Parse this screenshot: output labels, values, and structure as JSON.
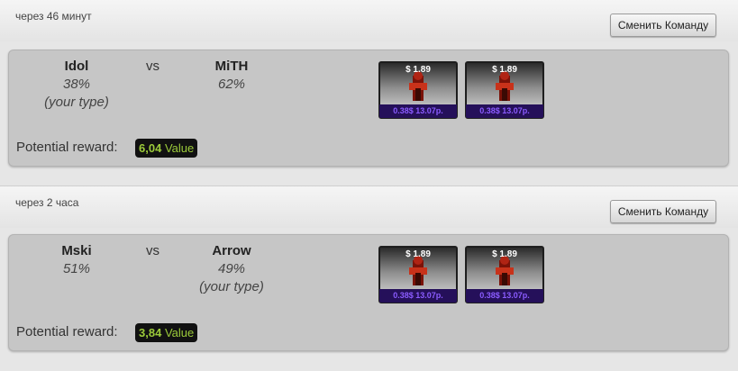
{
  "matches": [
    {
      "time": "через 46 минут",
      "change_team_label": "Сменить Команду",
      "team1": {
        "name": "Idol",
        "pct": "38%",
        "your_type": "(your type)"
      },
      "vs": "vs",
      "team2": {
        "name": "MiTH",
        "pct": "62%",
        "your_type": ""
      },
      "reward_label": "Potential reward:",
      "reward_value": "6,04",
      "reward_unit": "Value",
      "items": [
        {
          "price": "$ 1.89",
          "sub_price": "0.38$ 13.07р."
        },
        {
          "price": "$ 1.89",
          "sub_price": "0.38$ 13.07р."
        }
      ]
    },
    {
      "time": "через 2 часа",
      "change_team_label": "Сменить Команду",
      "team1": {
        "name": "Mski",
        "pct": "51%",
        "your_type": ""
      },
      "vs": "vs",
      "team2": {
        "name": "Arrow",
        "pct": "49%",
        "your_type": "(your type)"
      },
      "reward_label": "Potential reward:",
      "reward_value": "3,84",
      "reward_unit": "Value",
      "items": [
        {
          "price": "$ 1.89",
          "sub_price": "0.38$ 13.07р."
        },
        {
          "price": "$ 1.89",
          "sub_price": "0.38$ 13.07р."
        }
      ]
    }
  ]
}
